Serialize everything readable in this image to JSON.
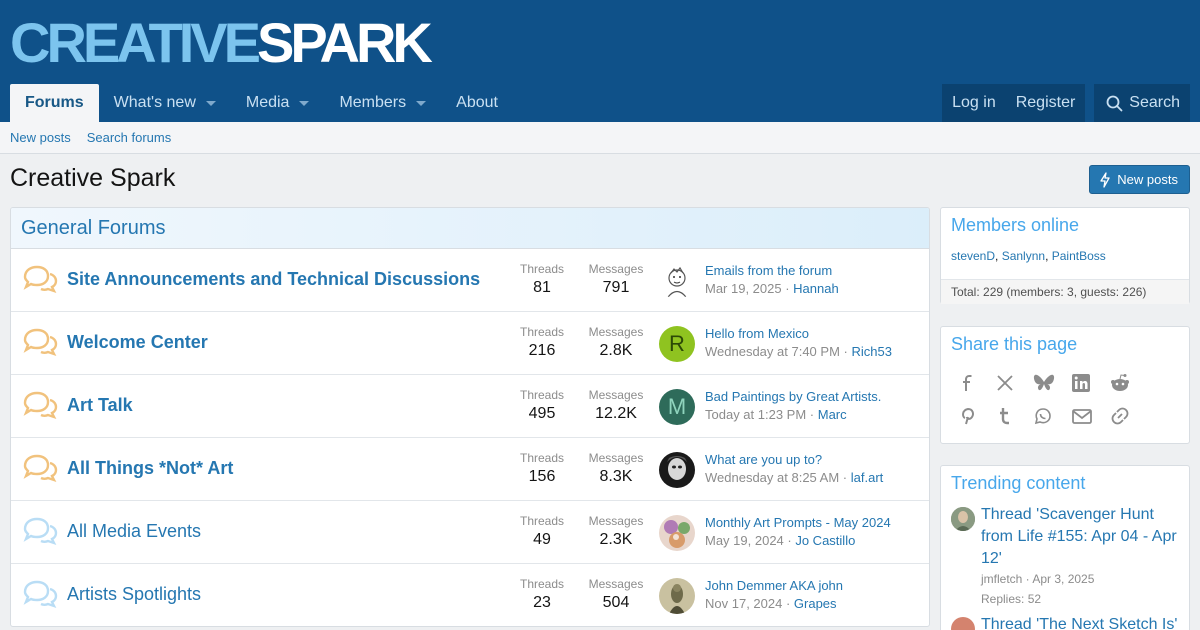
{
  "logo": {
    "part1": "CREATIVE",
    "part2": "SPARK"
  },
  "nav": {
    "tabs": [
      {
        "label": "Forums"
      },
      {
        "label": "What's new"
      },
      {
        "label": "Media"
      },
      {
        "label": "Members"
      },
      {
        "label": "About"
      }
    ],
    "login": "Log in",
    "register": "Register",
    "search": "Search"
  },
  "subnav": {
    "new_posts": "New posts",
    "search_forums": "Search forums"
  },
  "page": {
    "title": "Creative Spark",
    "new_posts_button": "New posts"
  },
  "forums": {
    "heading": "General Forums",
    "threads_label": "Threads",
    "messages_label": "Messages",
    "nodes": [
      {
        "title": "Site Announcements and Technical Discussions",
        "threads": "81",
        "messages": "791",
        "last_title": "Emails from the forum",
        "last_date": "Mar 19, 2025",
        "last_user": "Hannah",
        "avatar_letter": "",
        "unread": true
      },
      {
        "title": "Welcome Center",
        "threads": "216",
        "messages": "2.8K",
        "last_title": "Hello from Mexico",
        "last_date": "Wednesday at 7:40 PM",
        "last_user": "Rich53",
        "avatar_letter": "R",
        "unread": true
      },
      {
        "title": "Art Talk",
        "threads": "495",
        "messages": "12.2K",
        "last_title": "Bad Paintings by Great Artists.",
        "last_date": "Today at 1:23 PM",
        "last_user": "Marc",
        "avatar_letter": "M",
        "unread": true
      },
      {
        "title": "All Things *Not* Art",
        "threads": "156",
        "messages": "8.3K",
        "last_title": "What are you up to?",
        "last_date": "Wednesday at 8:25 AM",
        "last_user": "laf.art",
        "avatar_letter": "",
        "unread": true
      },
      {
        "title": "All Media Events",
        "threads": "49",
        "messages": "2.3K",
        "last_title": "Monthly Art Prompts - May 2024",
        "last_date": "May 19, 2024",
        "last_user": "Jo Castillo",
        "avatar_letter": "",
        "unread": false
      },
      {
        "title": "Artists Spotlights",
        "threads": "23",
        "messages": "504",
        "last_title": "John Demmer AKA john",
        "last_date": "Nov 17, 2024",
        "last_user": "Grapes",
        "avatar_letter": "",
        "unread": false
      }
    ]
  },
  "members_online": {
    "title": "Members online",
    "users": [
      "stevenD",
      "Sanlynn",
      "PaintBoss"
    ],
    "total": "Total: 229 (members: 3, guests: 226)"
  },
  "share": {
    "title": "Share this page",
    "icons": [
      "facebook-icon",
      "x-icon",
      "bluesky-icon",
      "linkedin-icon",
      "reddit-icon",
      "pinterest-icon",
      "tumblr-icon",
      "whatsapp-icon",
      "email-icon",
      "link-icon"
    ]
  },
  "trending": {
    "title": "Trending content",
    "items": [
      {
        "title": "Thread 'Scavenger Hunt from Life #155: Apr 04 - Apr 12'",
        "user": "jmfletch",
        "date": "Apr 3, 2025",
        "replies": "Replies: 52"
      },
      {
        "title": "Thread 'The Next Sketch Is'",
        "user": "",
        "date": "",
        "replies": ""
      }
    ]
  },
  "colors": {
    "header": "#0f5189",
    "link": "#2577b1",
    "unread_icon": "#f1c27d",
    "read_icon": "#b9ddf5"
  }
}
